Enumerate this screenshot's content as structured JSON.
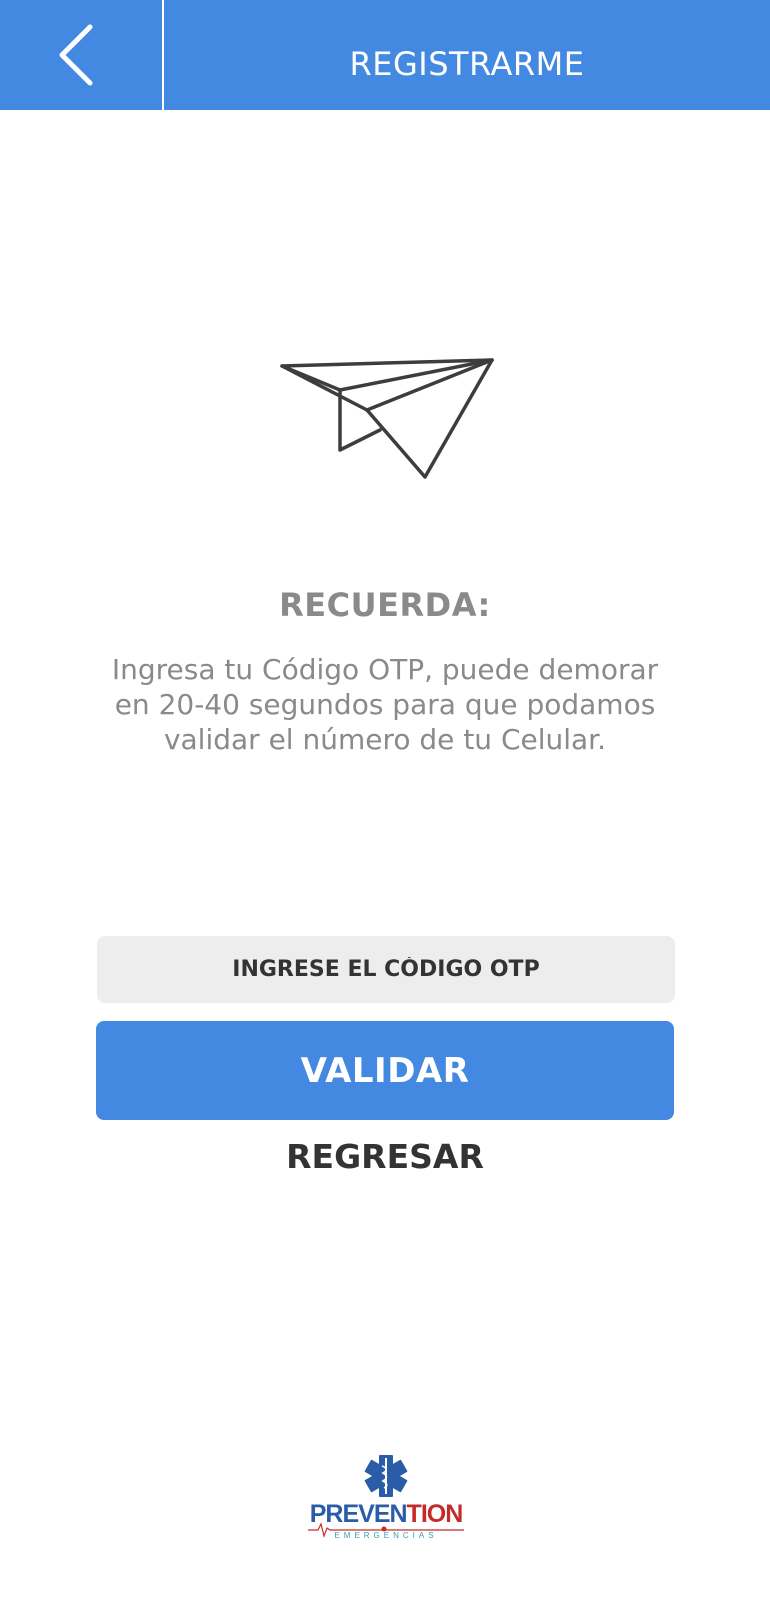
{
  "header": {
    "title": "REGISTRARME"
  },
  "message": {
    "heading": "RECUERDA:",
    "body": "Ingresa tu Código OTP, puede demorar en 20-40 segundos para que podamos validar el número de tu Celular."
  },
  "otp_input": {
    "value": "",
    "placeholder": "INGRESE EL CÓDIGO OTP"
  },
  "buttons": {
    "validate_label": "VALIDAR",
    "back_label": "REGRESAR"
  },
  "logo": {
    "brand_part1": "PREVEN",
    "brand_part2": "TION",
    "subtitle": "EMERGENCIAS"
  },
  "colors": {
    "primary": "#4489e1",
    "text_gray": "#8a8a8a",
    "text_dark": "#333333",
    "input_bg": "#ededed",
    "logo_blue": "#2a5ca8",
    "logo_red": "#c42b2b"
  },
  "icons": {
    "back": "chevron-left-icon",
    "illustration": "paper-plane-icon",
    "logo_symbol": "star-of-life-icon"
  }
}
